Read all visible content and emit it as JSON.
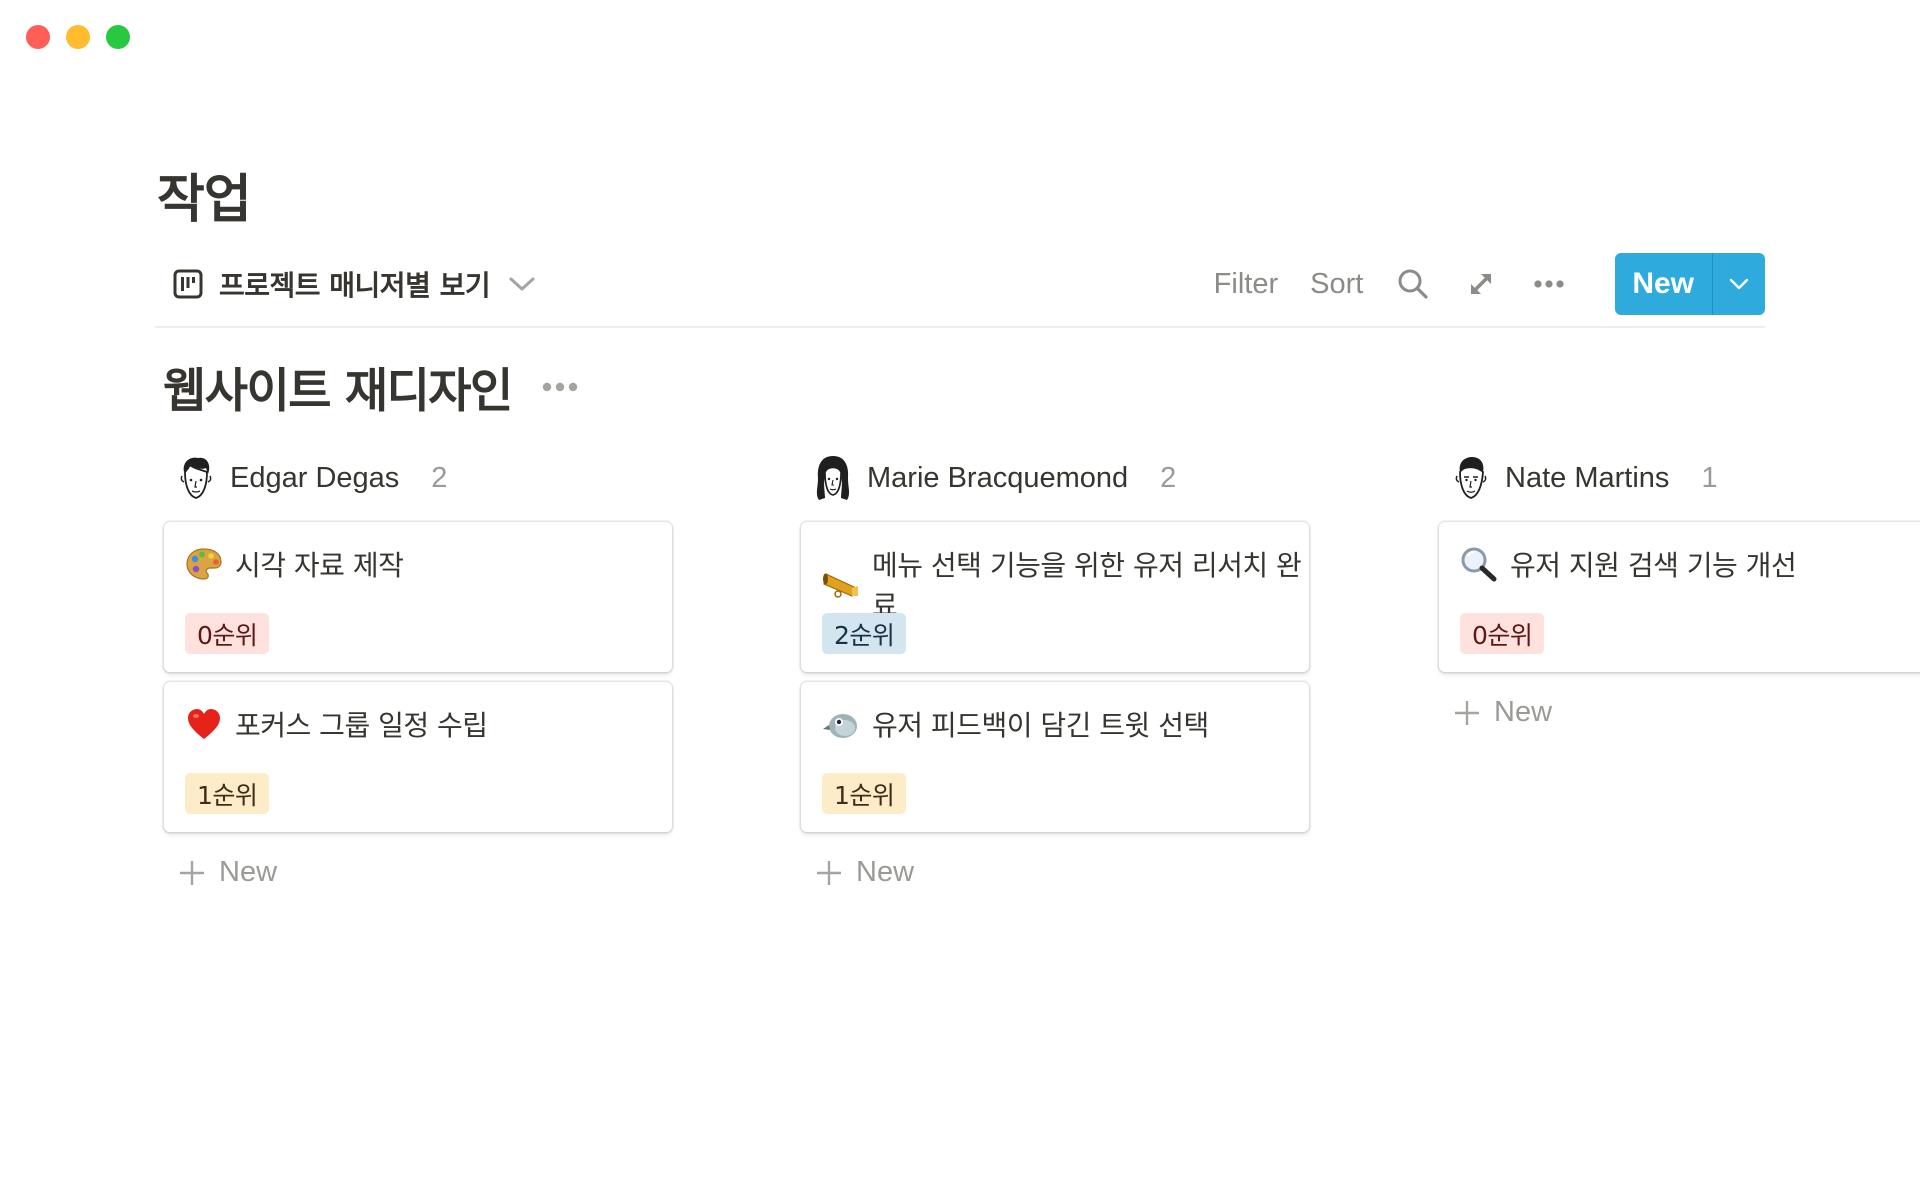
{
  "window": {
    "controls": [
      "close",
      "minimize",
      "zoom"
    ]
  },
  "page": {
    "title": "작업"
  },
  "view": {
    "label": "프로젝트 매니저별 보기",
    "icon": "board-icon"
  },
  "toolbar": {
    "filter_label": "Filter",
    "sort_label": "Sort",
    "search_icon": "search-icon",
    "expand_icon": "expand-icon",
    "more_icon": "more-icon",
    "new_label": "New",
    "accent_color": "#2eaadc"
  },
  "group": {
    "title": "웹사이트 재디자인"
  },
  "columns": [
    {
      "name": "Edgar Degas",
      "count": "2",
      "avatar": "edgar-avatar",
      "cards": [
        {
          "emoji": "🎨",
          "emoji_name": "palette-emoji",
          "title": "시각 자료 제작",
          "tag": "0순위",
          "tag_color": "red"
        },
        {
          "emoji": "❤️",
          "emoji_name": "heart-emoji",
          "title": "포커스 그룹 일정 수립",
          "tag": "1순위",
          "tag_color": "orange"
        }
      ],
      "add_label": "New"
    },
    {
      "name": "Marie Bracquemond",
      "count": "2",
      "avatar": "marie-avatar",
      "cards": [
        {
          "emoji": "📣",
          "emoji_name": "megaphone-emoji",
          "title": "메뉴 선택 기능을 위한 유저 리서치 완료",
          "tag": "2순위",
          "tag_color": "blue"
        },
        {
          "emoji": "🐦",
          "emoji_name": "bird-emoji",
          "title": "유저 피드백이 담긴 트윗 선택",
          "tag": "1순위",
          "tag_color": "orange"
        }
      ],
      "add_label": "New"
    },
    {
      "name": "Nate Martins",
      "count": "1",
      "avatar": "nate-avatar",
      "cards": [
        {
          "emoji": "🔍",
          "emoji_name": "magnifier-emoji",
          "title": "유저 지원 검색 기능 개선",
          "tag": "0순위",
          "tag_color": "red"
        }
      ],
      "add_label": "New"
    }
  ]
}
